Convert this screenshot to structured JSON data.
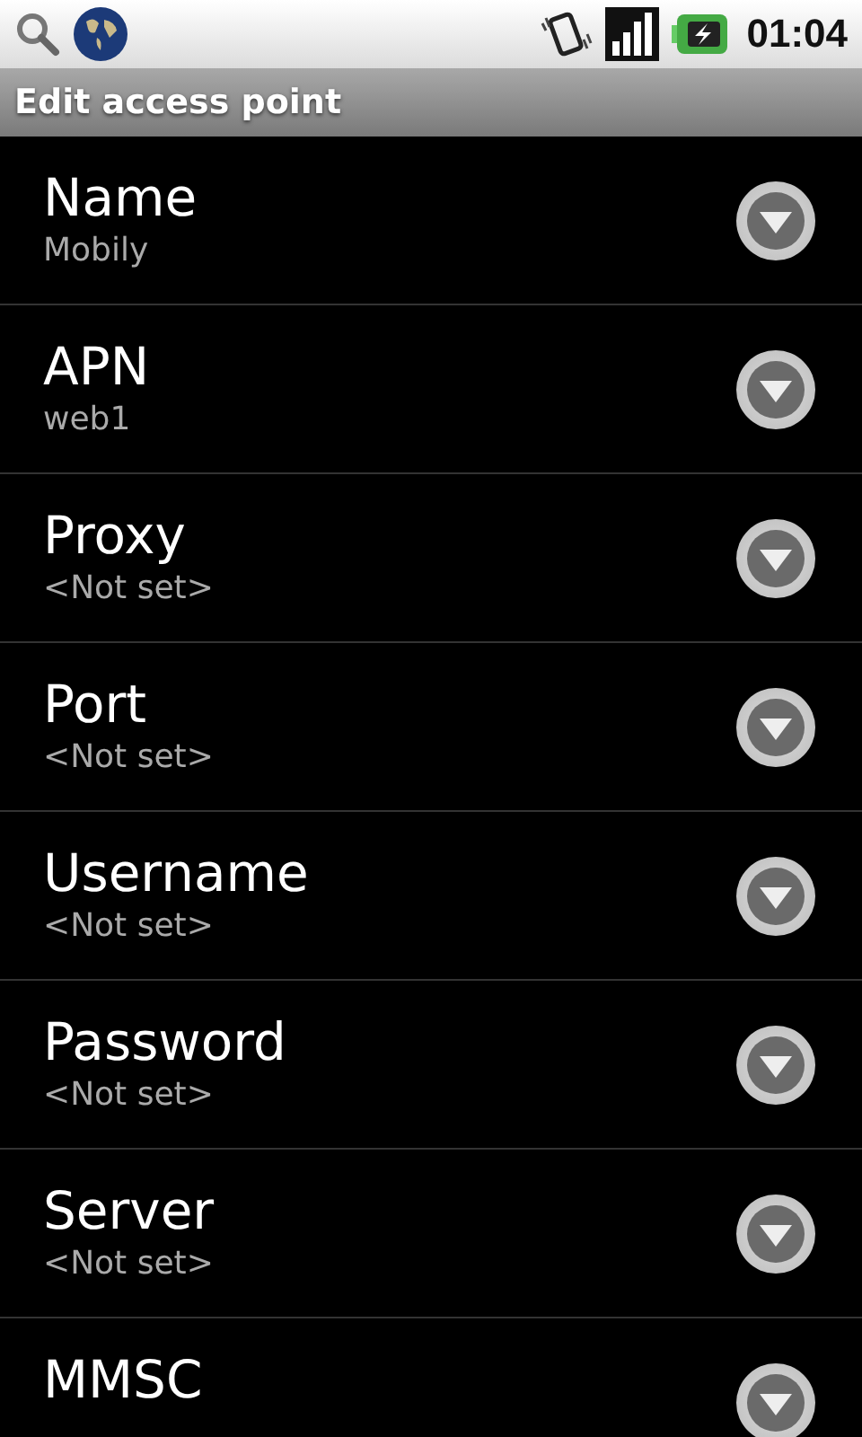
{
  "status_bar": {
    "time": "01:04"
  },
  "title_bar": {
    "title": "Edit access point"
  },
  "preferences": [
    {
      "title": "Name",
      "summary": "Mobily"
    },
    {
      "title": "APN",
      "summary": "web1"
    },
    {
      "title": "Proxy",
      "summary": "<Not set>"
    },
    {
      "title": "Port",
      "summary": "<Not set>"
    },
    {
      "title": "Username",
      "summary": "<Not set>"
    },
    {
      "title": "Password",
      "summary": "<Not set>"
    },
    {
      "title": "Server",
      "summary": "<Not set>"
    },
    {
      "title": "MMSC"
    }
  ]
}
